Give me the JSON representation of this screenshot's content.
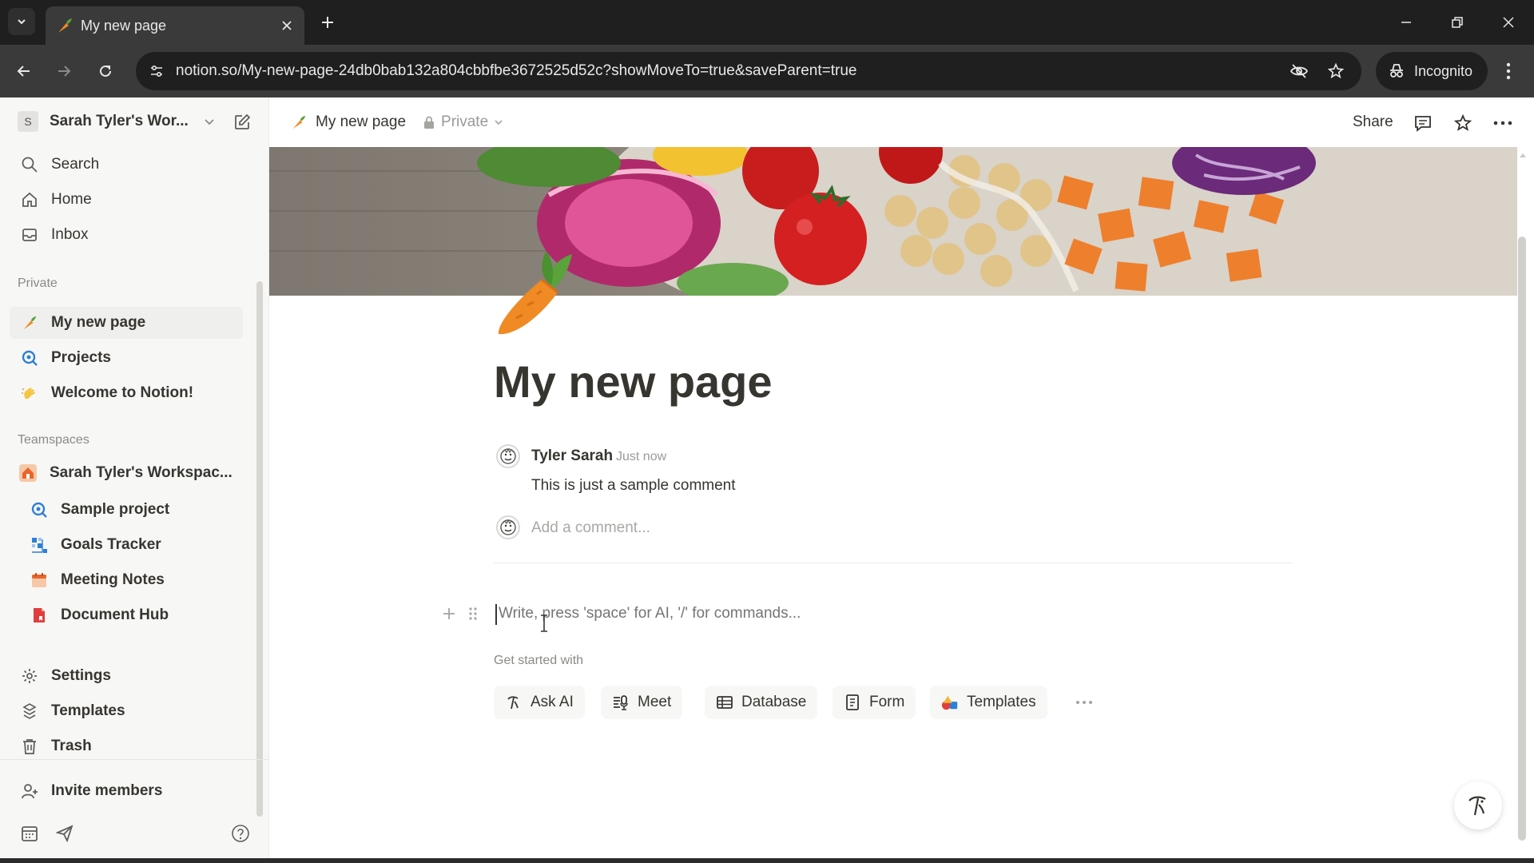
{
  "browser": {
    "tab_title": "My new page",
    "url": "notion.so/My-new-page-24db0bab132a804cbbfbe3672525d52c?showMoveTo=true&saveParent=true",
    "incognito_label": "Incognito"
  },
  "sidebar": {
    "workspace_name": "Sarah Tyler's Wor...",
    "workspace_initial": "S",
    "top_items": [
      {
        "label": "Search",
        "icon": "search-icon"
      },
      {
        "label": "Home",
        "icon": "home-icon"
      },
      {
        "label": "Inbox",
        "icon": "inbox-icon"
      }
    ],
    "private_heading": "Private",
    "private_items": [
      {
        "label": "My new page",
        "icon": "carrot-icon"
      },
      {
        "label": "Projects",
        "icon": "projects-icon"
      },
      {
        "label": "Welcome to Notion!",
        "icon": "wave-icon"
      }
    ],
    "teamspaces_heading": "Teamspaces",
    "teamspace": {
      "label": "Sarah Tyler's Workspac...",
      "icon": "house-icon"
    },
    "teamspace_items": [
      {
        "label": "Sample project",
        "icon": "projects-icon"
      },
      {
        "label": "Goals Tracker",
        "icon": "goals-icon"
      },
      {
        "label": "Meeting Notes",
        "icon": "calendar-icon"
      },
      {
        "label": "Document Hub",
        "icon": "document-icon"
      }
    ],
    "bottom_items": [
      {
        "label": "Settings",
        "icon": "gear-icon"
      },
      {
        "label": "Templates",
        "icon": "templates-icon"
      },
      {
        "label": "Trash",
        "icon": "trash-icon"
      }
    ],
    "invite_label": "Invite members"
  },
  "topbar": {
    "page_title": "My new page",
    "privacy": "Private",
    "share_label": "Share"
  },
  "page": {
    "title": "My new page",
    "comment": {
      "author": "Tyler Sarah",
      "time": "Just now",
      "body": "This is just a sample comment",
      "add_placeholder": "Add a comment..."
    },
    "block_placeholder": "Write, press 'space' for AI, '/' for commands...",
    "get_started_label": "Get started with",
    "chips": [
      {
        "label": "Ask AI",
        "icon": "ai-icon"
      },
      {
        "label": "Meet",
        "icon": "meet-icon"
      },
      {
        "label": "Database",
        "icon": "table-icon"
      },
      {
        "label": "Form",
        "icon": "form-icon"
      },
      {
        "label": "Templates",
        "icon": "templates-color-icon"
      }
    ]
  },
  "colors": {
    "accent": "#2383e2",
    "sidebar_bg": "#f7f7f5",
    "text": "#37352f",
    "muted": "#9b9a97",
    "carrot": "#f08a24"
  }
}
